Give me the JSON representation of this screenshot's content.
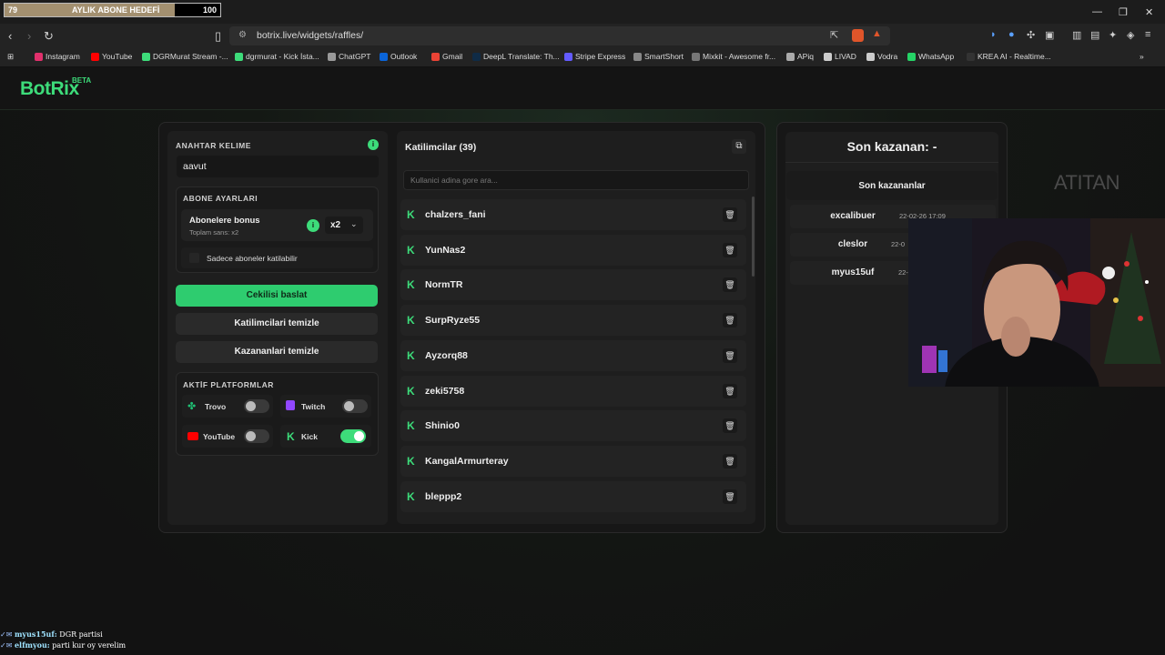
{
  "subgoal": {
    "left": "79",
    "label": "AYLIK ABONE HEDEFİ",
    "right": "100",
    "progress": 0.79
  },
  "browser": {
    "url": "botrix.live/widgets/raffles/",
    "bookmarks": [
      "Instagram",
      "YouTube",
      "DGRMurat Stream -...",
      "dgrmurat - Kick İsta...",
      "ChatGPT",
      "Outlook",
      "Gmail",
      "DeepL Translate: Th...",
      "Stripe Express",
      "SmartShort",
      "Mixkit - Awesome fr...",
      "APiq",
      "LIVAD",
      "Vodra",
      "WhatsApp",
      "KREA AI - Realtime..."
    ]
  },
  "app": {
    "logo": "BotRix",
    "beta": "BETA"
  },
  "left": {
    "keyword_label": "ANAHTAR KELIME",
    "keyword_value": "aavut",
    "sub_label": "ABONE AYARLARI",
    "sub_bonus_title": "Abonelere bonus",
    "sub_bonus_sub": "Toplam sans: x2",
    "sub_bonus_value": "x2",
    "only_subs": "Sadece aboneler katilabilir",
    "start": "Cekilisi baslat",
    "clear_participants": "Katilimcilari temizle",
    "clear_winners": "Kazananlari temizle",
    "platforms_label": "AKTİF PLATFORMLAR",
    "platforms": [
      {
        "name": "Trovo",
        "on": false
      },
      {
        "name": "Twitch",
        "on": false
      },
      {
        "name": "YouTube",
        "on": false
      },
      {
        "name": "Kick",
        "on": true
      }
    ]
  },
  "participants": {
    "title": "Katilimcilar (39)",
    "search_placeholder": "Kullanici adina gore ara...",
    "items": [
      "chalzers_fani",
      "YunNas2",
      "NormTR",
      "SurpRyze55",
      "Ayzorq88",
      "zeki5758",
      "Shinio0",
      "KangalArmurteray",
      "bleppp2"
    ]
  },
  "winners": {
    "title": "Son kazanan: -",
    "list_title": "Son kazananlar",
    "items": [
      {
        "name": "excalibuer",
        "date": "22-02-26 17:09"
      },
      {
        "name": "cleslor",
        "date": "22-0"
      },
      {
        "name": "myus15uf",
        "date": "22-"
      }
    ]
  },
  "overlay": {
    "watermark": "ATITAN"
  },
  "chat": [
    {
      "user": "myus15uf:",
      "msg": "DGR partisi"
    },
    {
      "user": "elfmyou:",
      "msg": "parti kur oy verelim"
    }
  ],
  "colors": {
    "accent": "#3ddc7a",
    "bg": "#121212"
  }
}
